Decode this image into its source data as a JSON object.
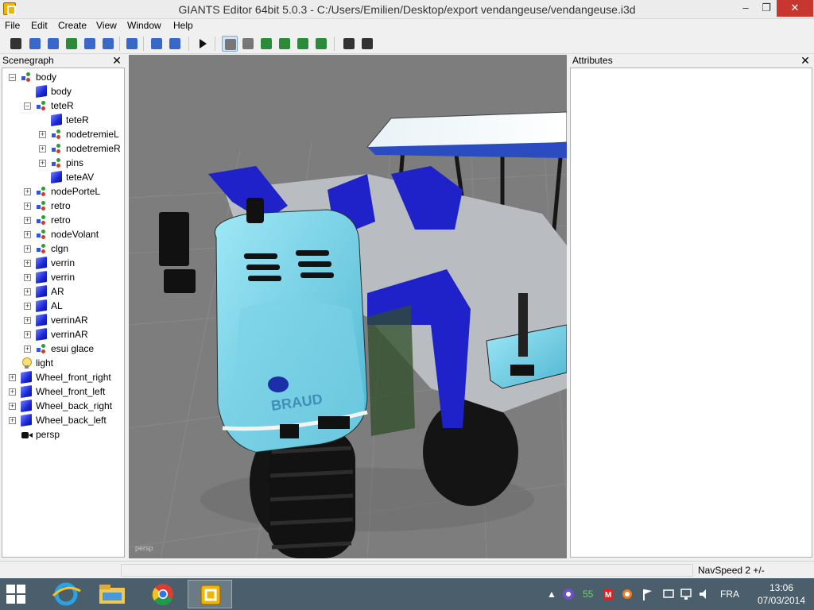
{
  "window": {
    "title": "GIANTS Editor 64bit 5.0.3 - C:/Users/Emilien/Desktop/export vendangeuse/vendangeuse.i3d",
    "minimize": "–",
    "maximize": "❐",
    "close": "✕"
  },
  "menu": [
    "File",
    "Edit",
    "Create",
    "View",
    "Window",
    "Help"
  ],
  "toolbar": {
    "icons": [
      "new-icon",
      "open-icon",
      "import-icon",
      "refresh-icon",
      "save-icon",
      "save-as-icon",
      "export-icon",
      "undo-icon",
      "redo-icon",
      "play-icon",
      "select-icon",
      "magnet-icon",
      "terrain-sculpt-icon",
      "terrain-paint-icon",
      "foliage-icon",
      "grass-icon",
      "checker-icon",
      "checker-settings-icon"
    ]
  },
  "scenegraph": {
    "title": "Scenegraph",
    "close": "✕",
    "nodes": [
      {
        "label": "body",
        "icon": "group-icon",
        "depth": 0,
        "expand": "–"
      },
      {
        "label": "body",
        "icon": "cube-icon",
        "depth": 1,
        "expand": ""
      },
      {
        "label": "teteR",
        "icon": "group-icon",
        "depth": 1,
        "expand": "–"
      },
      {
        "label": "teteR",
        "icon": "cube-icon",
        "depth": 2,
        "expand": ""
      },
      {
        "label": "nodetremieL",
        "icon": "group-icon",
        "depth": 2,
        "expand": "+"
      },
      {
        "label": "nodetremieR",
        "icon": "group-icon",
        "depth": 2,
        "expand": "+"
      },
      {
        "label": "pins",
        "icon": "group-icon",
        "depth": 2,
        "expand": "+"
      },
      {
        "label": "teteAV",
        "icon": "cube-icon",
        "depth": 2,
        "expand": ""
      },
      {
        "label": "nodePorteL",
        "icon": "group-icon",
        "depth": 1,
        "expand": "+"
      },
      {
        "label": "retro",
        "icon": "group-icon",
        "depth": 1,
        "expand": "+"
      },
      {
        "label": "retro",
        "icon": "group-icon",
        "depth": 1,
        "expand": "+"
      },
      {
        "label": "nodeVolant",
        "icon": "group-icon",
        "depth": 1,
        "expand": "+"
      },
      {
        "label": "clgn",
        "icon": "group-icon",
        "depth": 1,
        "expand": "+"
      },
      {
        "label": "verrin",
        "icon": "cube-icon",
        "depth": 1,
        "expand": "+"
      },
      {
        "label": "verrin",
        "icon": "cube-icon",
        "depth": 1,
        "expand": "+"
      },
      {
        "label": "AR",
        "icon": "cube-icon",
        "depth": 1,
        "expand": "+"
      },
      {
        "label": "AL",
        "icon": "cube-icon",
        "depth": 1,
        "expand": "+"
      },
      {
        "label": "verrinAR",
        "icon": "cube-icon",
        "depth": 1,
        "expand": "+"
      },
      {
        "label": "verrinAR",
        "icon": "cube-icon",
        "depth": 1,
        "expand": "+"
      },
      {
        "label": "esui glace",
        "icon": "group-icon",
        "depth": 1,
        "expand": "+"
      },
      {
        "label": "light",
        "icon": "light-icon",
        "depth": 0,
        "expand": ""
      },
      {
        "label": "Wheel_front_right",
        "icon": "cube-icon",
        "depth": 0,
        "expand": "+"
      },
      {
        "label": "Wheel_front_left",
        "icon": "cube-icon",
        "depth": 0,
        "expand": "+"
      },
      {
        "label": "Wheel_back_right",
        "icon": "cube-icon",
        "depth": 0,
        "expand": "+"
      },
      {
        "label": "Wheel_back_left",
        "icon": "cube-icon",
        "depth": 0,
        "expand": "+"
      },
      {
        "label": "persp",
        "icon": "camera-icon",
        "depth": 0,
        "expand": ""
      }
    ]
  },
  "viewport": {
    "camera_label": "persp",
    "decal_text": "BRAUD"
  },
  "attributes": {
    "title": "Attributes",
    "close": "✕"
  },
  "status": {
    "navspeed": "NavSpeed 2 +/-"
  },
  "taskbar": {
    "apps": [
      "internet-explorer-icon",
      "file-explorer-icon",
      "chrome-icon",
      "giants-editor-icon"
    ],
    "tray_count": "55",
    "language": "FRA",
    "time": "13:06",
    "date": "07/03/2014"
  }
}
